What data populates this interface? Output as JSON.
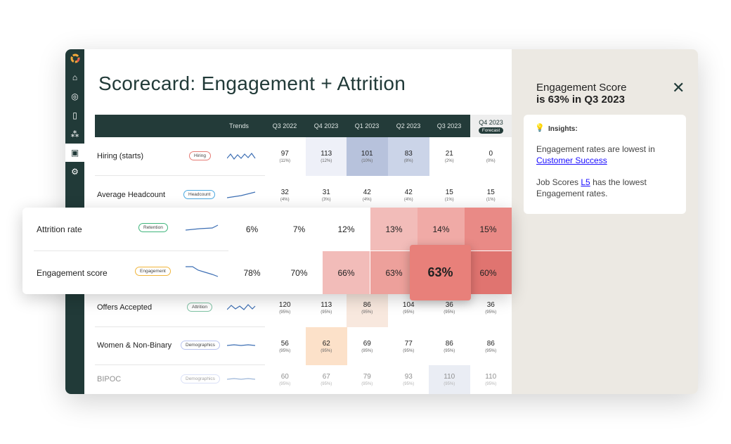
{
  "title": "Scorecard: Engagement + Attrition",
  "sidebar": {
    "items": [
      {
        "icon": "logo-icon"
      },
      {
        "icon": "home-icon"
      },
      {
        "icon": "target-icon"
      },
      {
        "icon": "scroll-icon"
      },
      {
        "icon": "shapes-icon"
      },
      {
        "icon": "badge-icon",
        "active": true
      },
      {
        "icon": "gear-icon"
      }
    ]
  },
  "table": {
    "headers": {
      "trends": "Trends",
      "cols": [
        "Q3 2022",
        "Q4 2023",
        "Q1 2023",
        "Q2 2023",
        "Q3 2023"
      ],
      "forecast_col": "Q4 2023",
      "forecast_badge": "Forecast"
    },
    "rows": [
      {
        "label": "Hiring (starts)",
        "tag": "Hiring",
        "values": [
          "97",
          "113",
          "101",
          "83",
          "21",
          "0"
        ],
        "pcts": [
          "(11%)",
          "(12%)",
          "(10%)",
          "(8%)",
          "(2%)",
          "(0%)"
        ]
      },
      {
        "label": "Average Headcount",
        "tag": "Headcount",
        "values": [
          "32",
          "31",
          "42",
          "42",
          "15",
          "15"
        ],
        "pcts": [
          "(4%)",
          "(3%)",
          "(4%)",
          "(4%)",
          "(1%)",
          "(1%)"
        ]
      },
      {
        "label": "Offers Accepted",
        "tag": "Attrition",
        "values": [
          "120",
          "113",
          "86",
          "104",
          "36",
          "36"
        ],
        "pcts": [
          "(95%)",
          "(95%)",
          "(95%)",
          "(95%)",
          "(95%)",
          "(95%)"
        ]
      },
      {
        "label": "Women & Non-Binary",
        "tag": "Demographics",
        "values": [
          "56",
          "62",
          "69",
          "77",
          "86",
          "86"
        ],
        "pcts": [
          "(95%)",
          "(95%)",
          "(95%)",
          "(95%)",
          "(95%)",
          "(95%)"
        ]
      },
      {
        "label": "BIPOC",
        "tag": "Demographics",
        "values": [
          "60",
          "67",
          "79",
          "93",
          "110",
          "110"
        ],
        "pcts": [
          "(95%)",
          "(95%)",
          "(95%)",
          "(95%)",
          "(95%)",
          "(95%)"
        ]
      }
    ]
  },
  "overlay": {
    "rows": [
      {
        "label": "Attrition rate",
        "tag": "Retention",
        "values": [
          "6%",
          "7%",
          "12%",
          "13%",
          "14%",
          "15%"
        ]
      },
      {
        "label": "Engagement score",
        "tag": "Engagement",
        "values": [
          "78%",
          "70%",
          "66%",
          "63%",
          "63%",
          "60%"
        ]
      }
    ]
  },
  "panel": {
    "title_line1": "Engagement Score",
    "title_line2": "is 63% in Q3 2023",
    "insights_label": "Insights:",
    "insight1_pre": "Engagement rates are lowest in ",
    "insight1_link": "Customer Success",
    "insight2_pre": "Job Scores ",
    "insight2_link": "L5",
    "insight2_post": " has the lowest Engagement rates."
  },
  "colors": {
    "sidebar": "#213a38",
    "panel": "#ece9e3",
    "heat_high": "#e8807a",
    "link": "#1a0dff"
  }
}
